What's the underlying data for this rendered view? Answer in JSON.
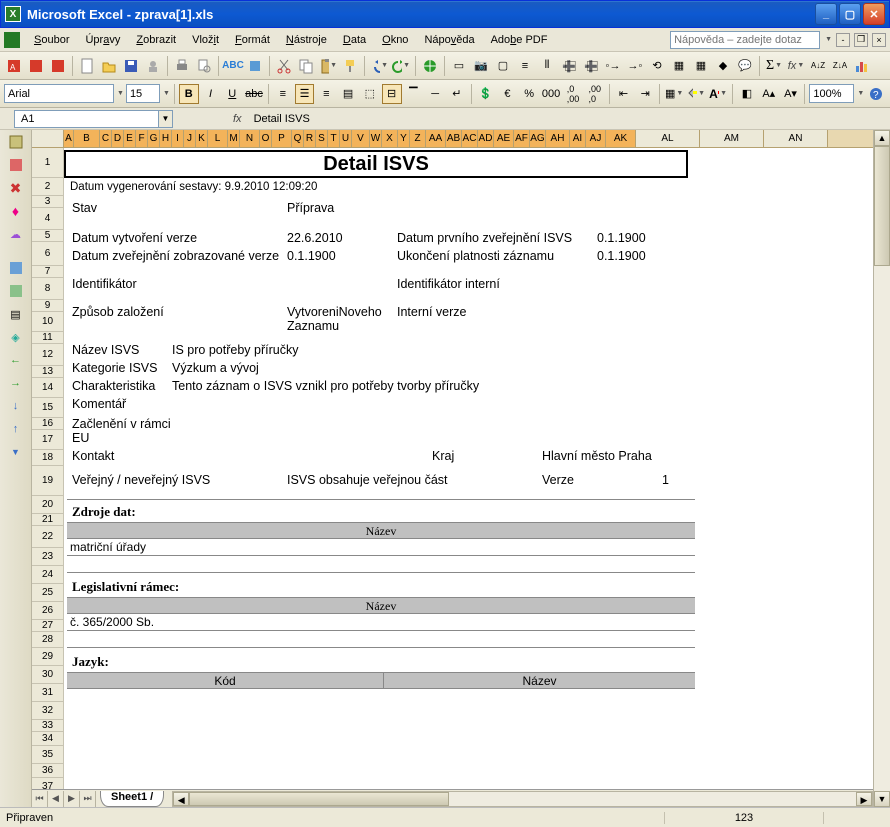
{
  "title": "Microsoft Excel - zprava[1].xls",
  "menus": [
    "Soubor",
    "Úpravy",
    "Zobrazit",
    "Vložit",
    "Formát",
    "Nástroje",
    "Data",
    "Okno",
    "Nápověda",
    "Adobe PDF"
  ],
  "help_placeholder": "Nápověda – zadejte dotaz",
  "font_name": "Arial",
  "font_size": "15",
  "zoom": "100%",
  "name_box": "A1",
  "formula": "Detail ISVS",
  "status": "Připraven",
  "status_num": "123",
  "sheet_tab": "Sheet1",
  "cols_selected": [
    "A",
    "B",
    "C",
    "D",
    "E",
    "F",
    "G",
    "H",
    "I",
    "J",
    "K",
    "L",
    "M",
    "N",
    "O",
    "P",
    "Q",
    "R",
    "S",
    "T",
    "U",
    "V",
    "W",
    "X",
    "Y",
    "Z",
    "AA",
    "AB",
    "AC",
    "AD",
    "AE",
    "AF",
    "AG",
    "AH",
    "AI",
    "AJ",
    "AK"
  ],
  "cols_rest": [
    "AL",
    "AM",
    "AN"
  ],
  "row_numbers": [
    "1",
    "2",
    "3",
    "4",
    "5",
    "6",
    "7",
    "8",
    "9",
    "10",
    "11",
    "12",
    "13",
    "14",
    "15",
    "16",
    "17",
    "18",
    "19",
    "20",
    "21",
    "22",
    "23",
    "24",
    "25",
    "26",
    "27",
    "28",
    "29",
    "30",
    "31",
    "32",
    "33",
    "34",
    "35",
    "36",
    "37"
  ],
  "doc": {
    "title": "Detail ISVS",
    "gen": "Datum vygenerování sestavy: 9.9.2010 12:09:20",
    "stav_l": "Stav",
    "stav_v": "Příprava",
    "dvv_l": "Datum vytvoření verze",
    "dvv_v": "22.6.2010",
    "dpz_l": "Datum prvního zveřejnění ISVS",
    "dpz_v": "0.1.1900",
    "dzz_l": "Datum zveřejnění zobrazované verze",
    "dzz_v": "0.1.1900",
    "upz_l": "Ukončení platnosti záznamu",
    "upz_v": "0.1.1900",
    "ident_l": "Identifikátor",
    "ident_int_l": "Identifikátor interní",
    "zpusob_l": "Způsob založení",
    "zpusob_v": "VytvoreniNoveho Zaznamu",
    "intverze_l": "Interní verze",
    "nazev_l": "Název ISVS",
    "nazev_v": "IS pro potřeby příručky",
    "kat_l": "Kategorie ISVS",
    "kat_v": "Výzkum a vývoj",
    "char_l": "Charakteristika",
    "char_v": "Tento záznam o ISVS vznikl pro potřeby tvorby příručky",
    "kom_l": "Komentář",
    "zacl_l": "Začlenění v rámci EU",
    "kontakt_l": "Kontakt",
    "kraj_l": "Kraj",
    "kraj_v": "Hlavní město Praha",
    "ver_l": "Veřejný / neveřejný ISVS",
    "ver_v": "ISVS obsahuje veřejnou část",
    "verze_l": "Verze",
    "verze_v": "1",
    "sec_zdroje": "Zdroje dat:",
    "col_nazev": "Název",
    "zd1": "matriční úřady",
    "sec_legis": "Legislativní rámec:",
    "leg1": "č. 365/2000 Sb.",
    "sec_jazyk": "Jazyk:",
    "col_kod": "Kód"
  }
}
